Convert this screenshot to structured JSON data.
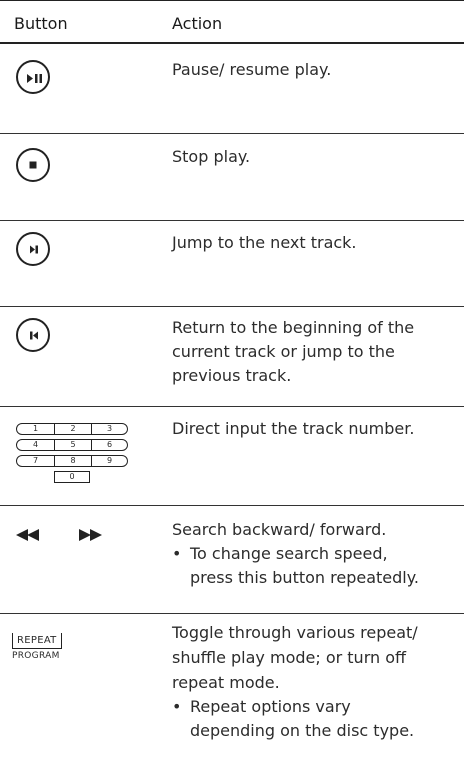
{
  "header": {
    "button": "Button",
    "action": "Action"
  },
  "rows": [
    {
      "icon": "play-pause-icon",
      "lines": [
        "Pause/ resume play."
      ]
    },
    {
      "icon": "stop-icon",
      "lines": [
        "Stop play."
      ]
    },
    {
      "icon": "next-track-icon",
      "lines": [
        "Jump to the next track."
      ]
    },
    {
      "icon": "previous-track-icon",
      "lines": [
        "Return to the beginning of the",
        "current track or jump to the",
        "previous track."
      ]
    },
    {
      "icon": "numeric-keypad-icon",
      "keys": [
        "1",
        "2",
        "3",
        "4",
        "5",
        "6",
        "7",
        "8",
        "9",
        "0"
      ],
      "lines": [
        "Direct input the track number."
      ]
    },
    {
      "icon": "search-arrows-icon",
      "lines": [
        "Search backward/ forward."
      ],
      "bullet": {
        "mark": "•",
        "lines": [
          "To change search speed,",
          "press this button repeatedly."
        ]
      }
    },
    {
      "icon": "repeat-program-button",
      "labels": [
        "REPEAT",
        "PROGRAM"
      ],
      "lines": [
        "Toggle through various repeat/",
        "shuffle play mode; or turn off",
        "repeat mode."
      ],
      "bullet": {
        "mark": "•",
        "lines": [
          "Repeat options vary",
          "depending on the disc type."
        ]
      }
    }
  ]
}
